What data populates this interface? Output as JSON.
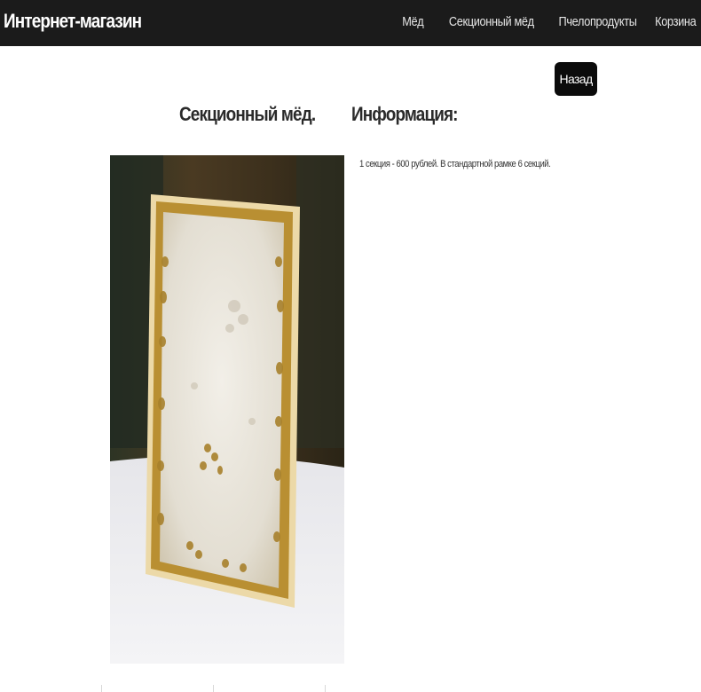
{
  "navbar": {
    "brand": "Интернет-магазин",
    "links": [
      "Мёд",
      "Секционный мёд",
      "Пчелопродукты",
      "Корзина"
    ]
  },
  "page": {
    "back_label": "Назад",
    "product_title": "Секционный мёд.",
    "info_title": "Информация:",
    "info_text": "1 секция - 600 рублей. В стандартной рамке 6 секций."
  },
  "colors": {
    "navbar_bg": "#1b1b1b",
    "button_bg": "#0b0b0b"
  }
}
